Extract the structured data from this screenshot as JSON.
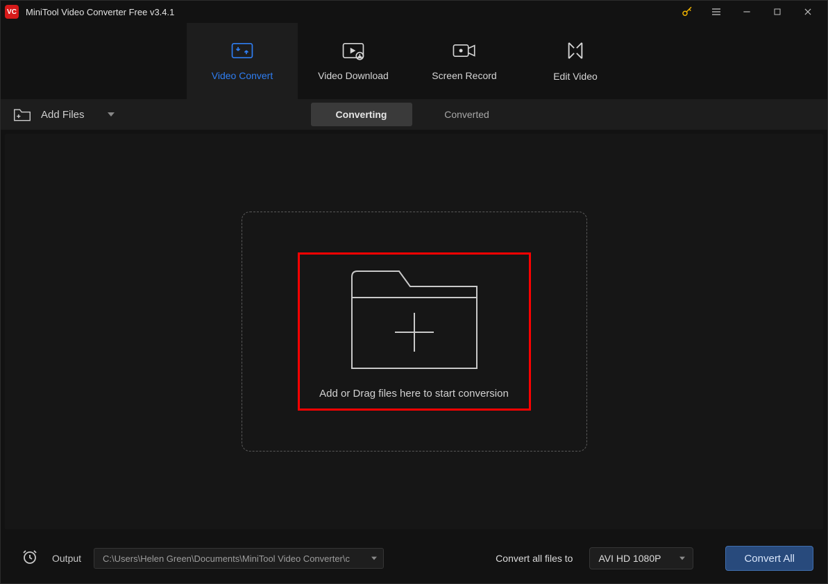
{
  "titlebar": {
    "app_name": "MiniTool Video Converter Free v3.4.1"
  },
  "main_tabs": {
    "items": [
      {
        "label": "Video Convert"
      },
      {
        "label": "Video Download"
      },
      {
        "label": "Screen Record"
      },
      {
        "label": "Edit Video"
      }
    ]
  },
  "toolbar": {
    "add_files_label": "Add Files",
    "converting_label": "Converting",
    "converted_label": "Converted"
  },
  "dropzone": {
    "text": "Add or Drag files here to start conversion"
  },
  "footer": {
    "output_label": "Output",
    "output_path": "C:\\Users\\Helen Green\\Documents\\MiniTool Video Converter\\c",
    "convert_all_label": "Convert all files to",
    "format_value": "AVI HD 1080P",
    "convert_all_button": "Convert All"
  }
}
